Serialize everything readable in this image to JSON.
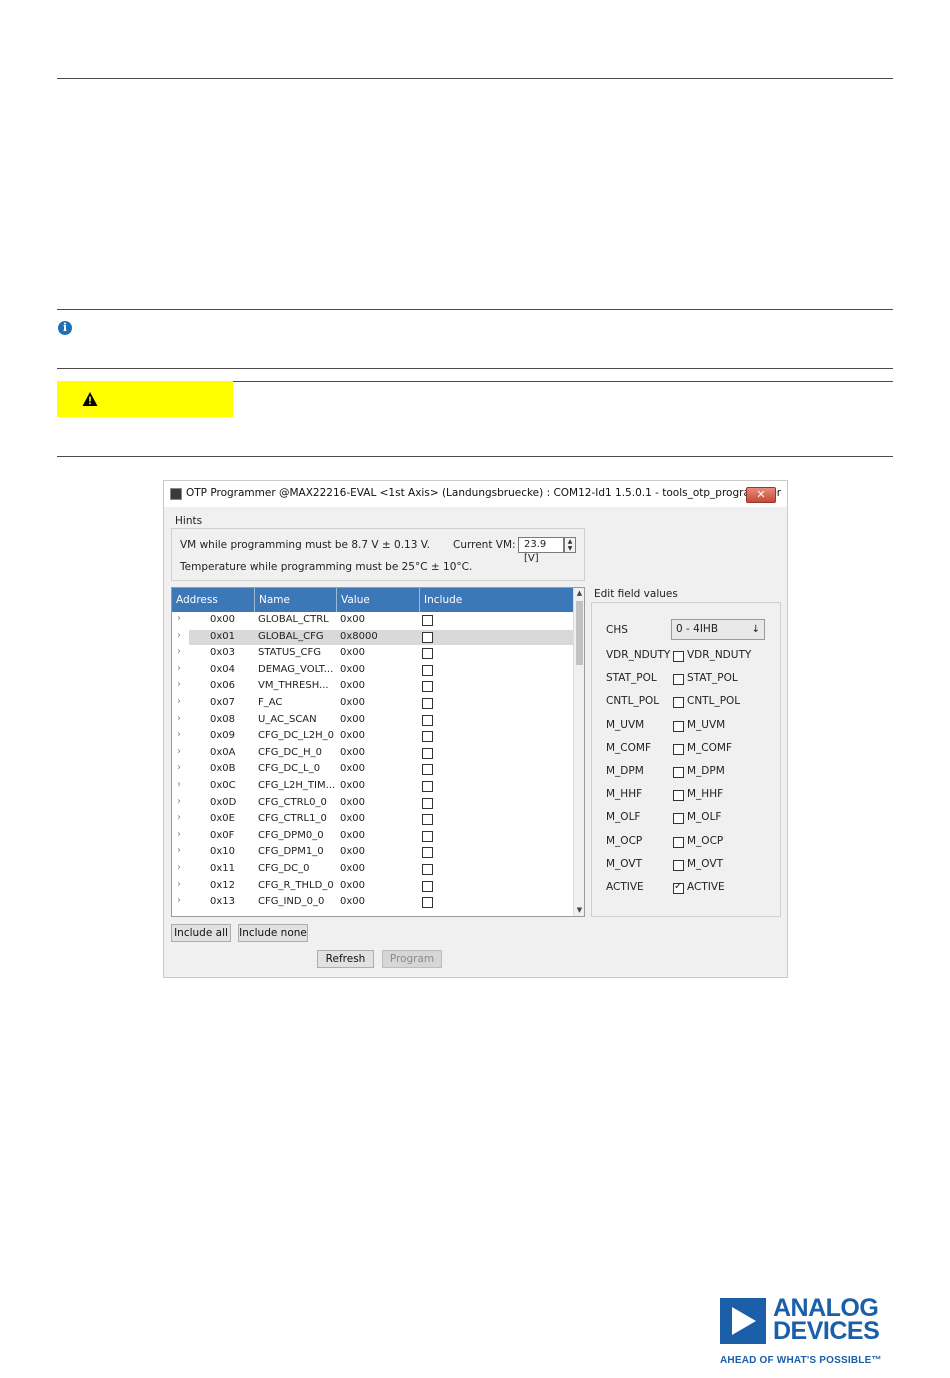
{
  "window": {
    "title": "OTP Programmer @MAX22216-EVAL <1st Axis> (Landungsbruecke) : COM12-Id1 1.5.0.1 - tools_otp_programmer",
    "close_glyph": "✕"
  },
  "hints": {
    "label": "Hints",
    "vm_hint": "VM while programming must be 8.7 V ± 0.13 V.",
    "temp_hint": "Temperature while programming must be 25°C ± 10°C.",
    "current_vm_label": "Current VM:",
    "current_vm_value": "23.9 [V]"
  },
  "table": {
    "columns": [
      "Address",
      "Name",
      "Value",
      "Include"
    ],
    "rows": [
      {
        "address": "0x00",
        "name": "GLOBAL_CTRL",
        "value": "0x00"
      },
      {
        "address": "0x01",
        "name": "GLOBAL_CFG",
        "value": "0x8000"
      },
      {
        "address": "0x03",
        "name": "STATUS_CFG",
        "value": "0x00"
      },
      {
        "address": "0x04",
        "name": "DEMAG_VOLT...",
        "value": "0x00"
      },
      {
        "address": "0x06",
        "name": "VM_THRESH...",
        "value": "0x00"
      },
      {
        "address": "0x07",
        "name": "F_AC",
        "value": "0x00"
      },
      {
        "address": "0x08",
        "name": "U_AC_SCAN",
        "value": "0x00"
      },
      {
        "address": "0x09",
        "name": "CFG_DC_L2H_0",
        "value": "0x00"
      },
      {
        "address": "0x0A",
        "name": "CFG_DC_H_0",
        "value": "0x00"
      },
      {
        "address": "0x0B",
        "name": "CFG_DC_L_0",
        "value": "0x00"
      },
      {
        "address": "0x0C",
        "name": "CFG_L2H_TIM...",
        "value": "0x00"
      },
      {
        "address": "0x0D",
        "name": "CFG_CTRL0_0",
        "value": "0x00"
      },
      {
        "address": "0x0E",
        "name": "CFG_CTRL1_0",
        "value": "0x00"
      },
      {
        "address": "0x0F",
        "name": "CFG_DPM0_0",
        "value": "0x00"
      },
      {
        "address": "0x10",
        "name": "CFG_DPM1_0",
        "value": "0x00"
      },
      {
        "address": "0x11",
        "name": "CFG_DC_0",
        "value": "0x00"
      },
      {
        "address": "0x12",
        "name": "CFG_R_THLD_0",
        "value": "0x00"
      },
      {
        "address": "0x13",
        "name": "CFG_IND_0_0",
        "value": "0x00"
      }
    ],
    "selected_row": "0x01",
    "chevron": "›"
  },
  "buttons": {
    "include_all": "Include all",
    "include_none": "Include none",
    "refresh": "Refresh",
    "program": "Program"
  },
  "edit": {
    "label": "Edit field values",
    "chs_label": "CHS",
    "chs_value": "0 - 4IHB",
    "fields": [
      {
        "label": "VDR_NDUTY",
        "checked": false
      },
      {
        "label": "STAT_POL",
        "checked": false
      },
      {
        "label": "CNTL_POL",
        "checked": false
      },
      {
        "label": "M_UVM",
        "checked": false
      },
      {
        "label": "M_COMF",
        "checked": false
      },
      {
        "label": "M_DPM",
        "checked": false
      },
      {
        "label": "M_HHF",
        "checked": false
      },
      {
        "label": "M_OLF",
        "checked": false
      },
      {
        "label": "M_OCP",
        "checked": false
      },
      {
        "label": "M_OVT",
        "checked": false
      },
      {
        "label": "ACTIVE",
        "checked": true
      }
    ]
  },
  "logo": {
    "line1": "ANALOG",
    "line2": "DEVICES",
    "tagline": "AHEAD OF WHAT'S POSSIBLE™"
  },
  "colors": {
    "table_header": "#3c78b8",
    "caution": "#ffff00",
    "brand": "#1a5fa8"
  }
}
